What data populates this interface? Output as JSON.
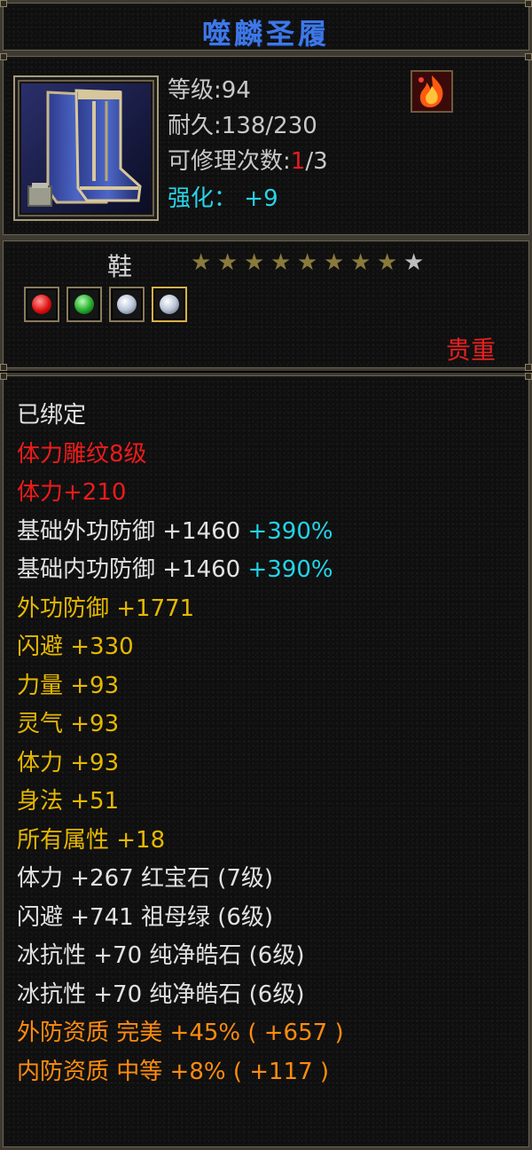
{
  "title": "噬麟圣履",
  "item": {
    "level_label": "等级",
    "level_value": "94",
    "durability_label": "耐久",
    "durability_value": "138/230",
    "repair_label": "可修理次数",
    "repair_current": "1",
    "repair_max": "/3",
    "enhance_label": "强化：",
    "enhance_value": "+9",
    "icon": "boot-icon",
    "badge_icon": "fire-element-icon"
  },
  "info": {
    "type": "鞋",
    "stars_filled": 8,
    "stars_total": 9,
    "gems": [
      "ruby-gem-icon",
      "emerald-gem-icon",
      "diamond-gem-icon",
      "diamond-gem-icon"
    ],
    "rarity": "贵重"
  },
  "attributes": [
    {
      "parts": [
        {
          "text": "已绑定",
          "color": "white"
        }
      ]
    },
    {
      "parts": [
        {
          "text": "体力雕纹8级",
          "color": "red"
        }
      ]
    },
    {
      "parts": [
        {
          "text": "体力+210",
          "color": "red"
        }
      ]
    },
    {
      "parts": [
        {
          "text": "基础外功防御  +1460 ",
          "color": "white"
        },
        {
          "text": "+390%",
          "color": "cyan"
        }
      ]
    },
    {
      "parts": [
        {
          "text": "基础内功防御  +1460 ",
          "color": "white"
        },
        {
          "text": "+390%",
          "color": "cyan"
        }
      ]
    },
    {
      "parts": [
        {
          "text": "外功防御  +1771",
          "color": "gold"
        }
      ]
    },
    {
      "parts": [
        {
          "text": "闪避  +330",
          "color": "gold"
        }
      ]
    },
    {
      "parts": [
        {
          "text": "力量  +93",
          "color": "gold"
        }
      ]
    },
    {
      "parts": [
        {
          "text": "灵气  +93",
          "color": "gold"
        }
      ]
    },
    {
      "parts": [
        {
          "text": "体力  +93",
          "color": "gold"
        }
      ]
    },
    {
      "parts": [
        {
          "text": "身法  +51",
          "color": "gold"
        }
      ]
    },
    {
      "parts": [
        {
          "text": "所有属性  +18",
          "color": "gold"
        }
      ]
    },
    {
      "parts": [
        {
          "text": "体力  +267  红宝石 (7级)",
          "color": "white"
        }
      ]
    },
    {
      "parts": [
        {
          "text": "闪避  +741  祖母绿 (6级)",
          "color": "white"
        }
      ]
    },
    {
      "parts": [
        {
          "text": "冰抗性  +70  纯净皓石 (6级)",
          "color": "white"
        }
      ]
    },
    {
      "parts": [
        {
          "text": "冰抗性  +70  纯净皓石 (6级)",
          "color": "white"
        }
      ]
    },
    {
      "parts": [
        {
          "text": "外防资质   完美  +45% ( +657 )",
          "color": "orange"
        }
      ]
    },
    {
      "parts": [
        {
          "text": "内防资质   中等  +8% ( +117 )",
          "color": "orange"
        }
      ]
    }
  ],
  "colors": {
    "white": "#e2e2e2",
    "red": "#ed1b1b",
    "gold": "#e6b800",
    "orange": "#ff8c10",
    "cyan": "#22d4e8",
    "star_filled": "#8a7a3c",
    "star_empty": "#bdbdbd"
  }
}
